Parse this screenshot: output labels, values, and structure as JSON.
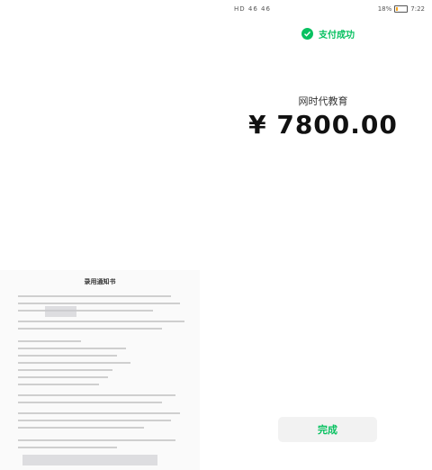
{
  "status_bar": {
    "left_text": "HD 46 46",
    "battery": "18%",
    "battery_level": 0.18,
    "time": "7:22"
  },
  "payment": {
    "status": "支付成功",
    "merchant": "网时代教育",
    "amount": "¥ 7800.00",
    "accent_color": "#07c160"
  },
  "button": {
    "done_label": "完成"
  },
  "document": {
    "title": "录用通知书"
  }
}
